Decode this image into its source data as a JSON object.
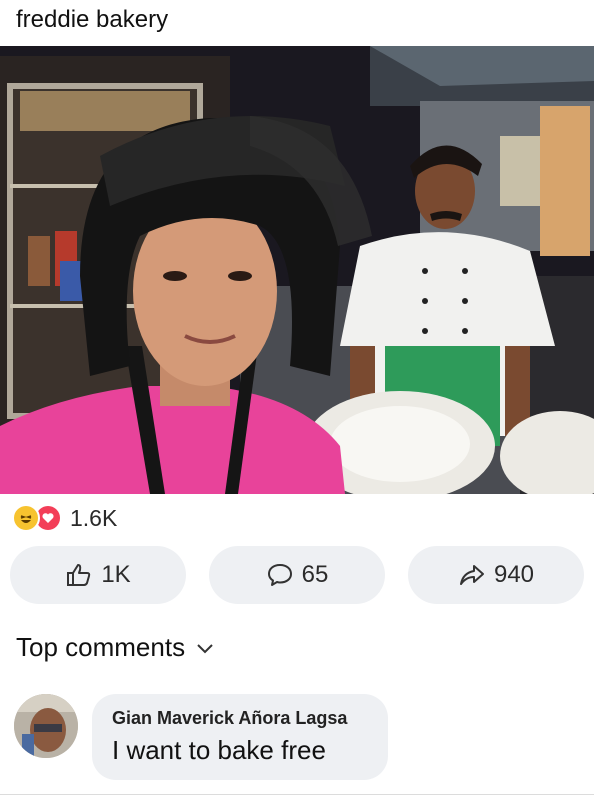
{
  "post": {
    "caption": "freddie bakery"
  },
  "reactions": {
    "icons": [
      "haha-icon",
      "love-icon"
    ],
    "count": "1.6K"
  },
  "actions": {
    "like_count": "1K",
    "comment_count": "65",
    "share_count": "940"
  },
  "comments": {
    "header": "Top comments",
    "items": [
      {
        "author": "Gian Maverick Añora Lagsa",
        "text": "I want to bake free"
      }
    ]
  },
  "colors": {
    "pill_bg": "#eef0f3",
    "haha": "#f7c32f",
    "love": "#f33e58",
    "shirt_pink": "#e8439a",
    "apron_green": "#2e9b5a"
  }
}
